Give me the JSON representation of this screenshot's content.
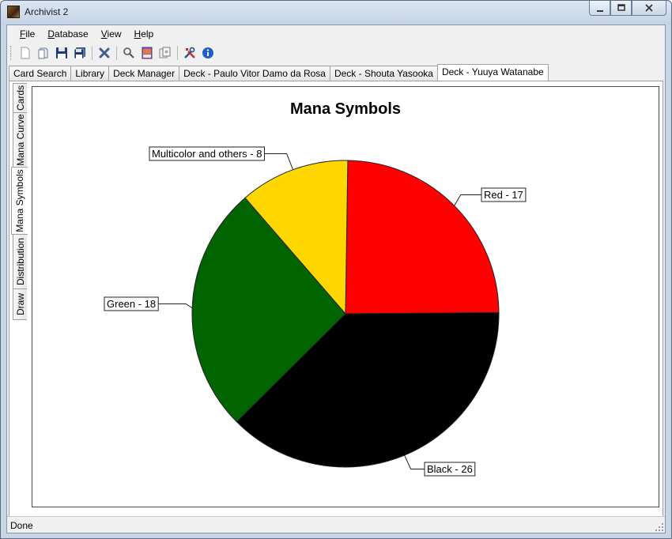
{
  "window": {
    "title": "Archivist 2",
    "controls": {
      "minimize": "—",
      "maximize": "□",
      "close": "✕"
    }
  },
  "menubar": {
    "items": [
      {
        "label": "File",
        "underline": "F",
        "rest": "ile"
      },
      {
        "label": "Database",
        "underline": "D",
        "rest": "atabase"
      },
      {
        "label": "View",
        "underline": "V",
        "rest": "iew"
      },
      {
        "label": "Help",
        "underline": "H",
        "rest": "elp"
      }
    ]
  },
  "toolbar": {
    "icons": [
      "new-icon",
      "open-icon",
      "save-icon",
      "save-all-icon",
      "delete-icon",
      "search-icon",
      "card-image-icon",
      "cards-icon",
      "tools-icon",
      "info-icon"
    ]
  },
  "tabs": {
    "items": [
      "Card Search",
      "Library",
      "Deck Manager",
      "Deck - Paulo Vitor Damo da Rosa",
      "Deck - Shouta Yasooka",
      "Deck - Yuuya Watanabe"
    ],
    "active": 5
  },
  "side_tabs": {
    "items": [
      "Cards",
      "Mana Curve",
      "Mana Symbols",
      "Distribution",
      "Draw"
    ],
    "active": 2
  },
  "chart_data": {
    "type": "pie",
    "title": "Mana Symbols",
    "slices": [
      {
        "label": "Red - 17",
        "name": "Red",
        "value": 17,
        "color": "#ff0000"
      },
      {
        "label": "Black - 26",
        "name": "Black",
        "value": 26,
        "color": "#000000"
      },
      {
        "label": "Green - 18",
        "name": "Green",
        "value": 18,
        "color": "#006400"
      },
      {
        "label": "Multicolor and others - 8",
        "name": "Multicolor and others",
        "value": 8,
        "color": "#ffd700"
      }
    ]
  },
  "status": {
    "text": "Done"
  }
}
